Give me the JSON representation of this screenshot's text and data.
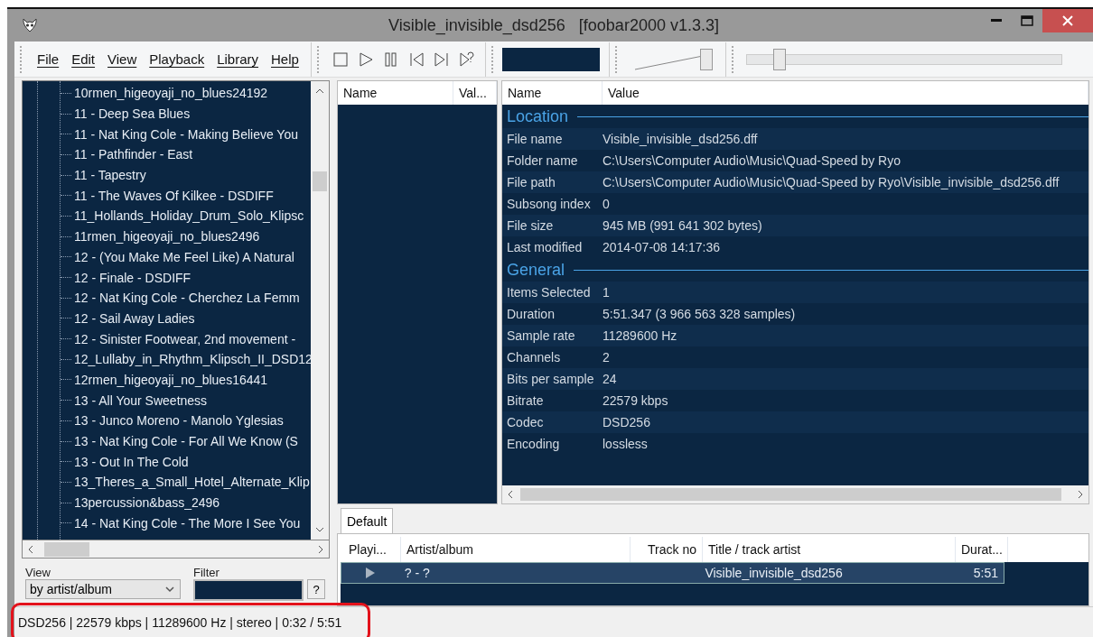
{
  "window": {
    "title": "Visible_invisible_dsd256   [foobar2000 v1.3.3]"
  },
  "menu": [
    "File",
    "Edit",
    "View",
    "Playback",
    "Library",
    "Help"
  ],
  "volume": {
    "level": 0.95
  },
  "seek": {
    "level": 0.09
  },
  "tree": {
    "items": [
      {
        "label": "10rmen_higeoyaji_no_blues24192"
      },
      {
        "label": "11 - Deep Sea Blues"
      },
      {
        "label": "11 - Nat King Cole - Making Believe You"
      },
      {
        "label": "11 - Pathfinder - East"
      },
      {
        "label": "11 - Tapestry"
      },
      {
        "label": "11 - The Waves Of Kilkee - DSDIFF"
      },
      {
        "label": "11_Hollands_Holiday_Drum_Solo_Klipsc"
      },
      {
        "label": "11rmen_higeoyaji_no_blues2496"
      },
      {
        "label": "12 - (You Make Me Feel Like) A Natural"
      },
      {
        "label": "12 - Finale - DSDIFF"
      },
      {
        "label": "12 - Nat King Cole - Cherchez La Femm"
      },
      {
        "label": "12 - Sail Away Ladies"
      },
      {
        "label": "12 - Sinister Footwear, 2nd movement -"
      },
      {
        "label": "12_Lullaby_in_Rhythm_Klipsch_II_DSD12"
      },
      {
        "label": "12rmen_higeoyaji_no_blues16441"
      },
      {
        "label": "13 - All Your Sweetness"
      },
      {
        "label": "13 - Junco Moreno - Manolo Yglesias"
      },
      {
        "label": "13 - Nat King Cole - For All We Know (S"
      },
      {
        "label": "13 - Out In The Cold"
      },
      {
        "label": "13_Theres_a_Small_Hotel_Alternate_Klip"
      },
      {
        "label": "13percussion&bass_2496"
      },
      {
        "label": "14 - Nat King Cole - The More I See You"
      }
    ]
  },
  "view": {
    "label": "View",
    "value": "by artist/album"
  },
  "filter": {
    "label": "Filter",
    "help": "?"
  },
  "middle_panel": {
    "columns": [
      "Name",
      "Val..."
    ]
  },
  "properties": {
    "columns": [
      "Name",
      "Value"
    ],
    "sections": [
      {
        "title": "Location",
        "rows": [
          {
            "name": "File name",
            "value": "Visible_invisible_dsd256.dff"
          },
          {
            "name": "Folder name",
            "value": "C:\\Users\\Computer Audio\\Music\\Quad-Speed by Ryo"
          },
          {
            "name": "File path",
            "value": "C:\\Users\\Computer Audio\\Music\\Quad-Speed by Ryo\\Visible_invisible_dsd256.dff"
          },
          {
            "name": "Subsong index",
            "value": "0"
          },
          {
            "name": "File size",
            "value": "945 MB (991 641 302 bytes)"
          },
          {
            "name": "Last modified",
            "value": "2014-07-08 14:17:36"
          }
        ]
      },
      {
        "title": "General",
        "rows": [
          {
            "name": "Items Selected",
            "value": "1"
          },
          {
            "name": "Duration",
            "value": "5:51.347 (3 966 563 328 samples)"
          },
          {
            "name": "Sample rate",
            "value": "11289600 Hz"
          },
          {
            "name": "Channels",
            "value": "2"
          },
          {
            "name": "Bits per sample",
            "value": "24"
          },
          {
            "name": "Bitrate",
            "value": "22579 kbps"
          },
          {
            "name": "Codec",
            "value": "DSD256"
          },
          {
            "name": "Encoding",
            "value": "lossless"
          }
        ]
      }
    ]
  },
  "playlist_tabs": [
    {
      "label": "Default",
      "selected": true
    }
  ],
  "playlist": {
    "columns": [
      "Playi...",
      "Artist/album",
      "Track no",
      "Title / track artist",
      "Durat..."
    ],
    "rows": [
      {
        "playing": true,
        "selected": true,
        "artist_album": "? - ?",
        "track_no": "",
        "title": "Visible_invisible_dsd256",
        "duration": "5:51"
      }
    ]
  },
  "status_bar": {
    "text": "DSD256 | 22579 kbps | 11289600 Hz | stereo | 0:32 / 5:51",
    "highlighted": true
  }
}
